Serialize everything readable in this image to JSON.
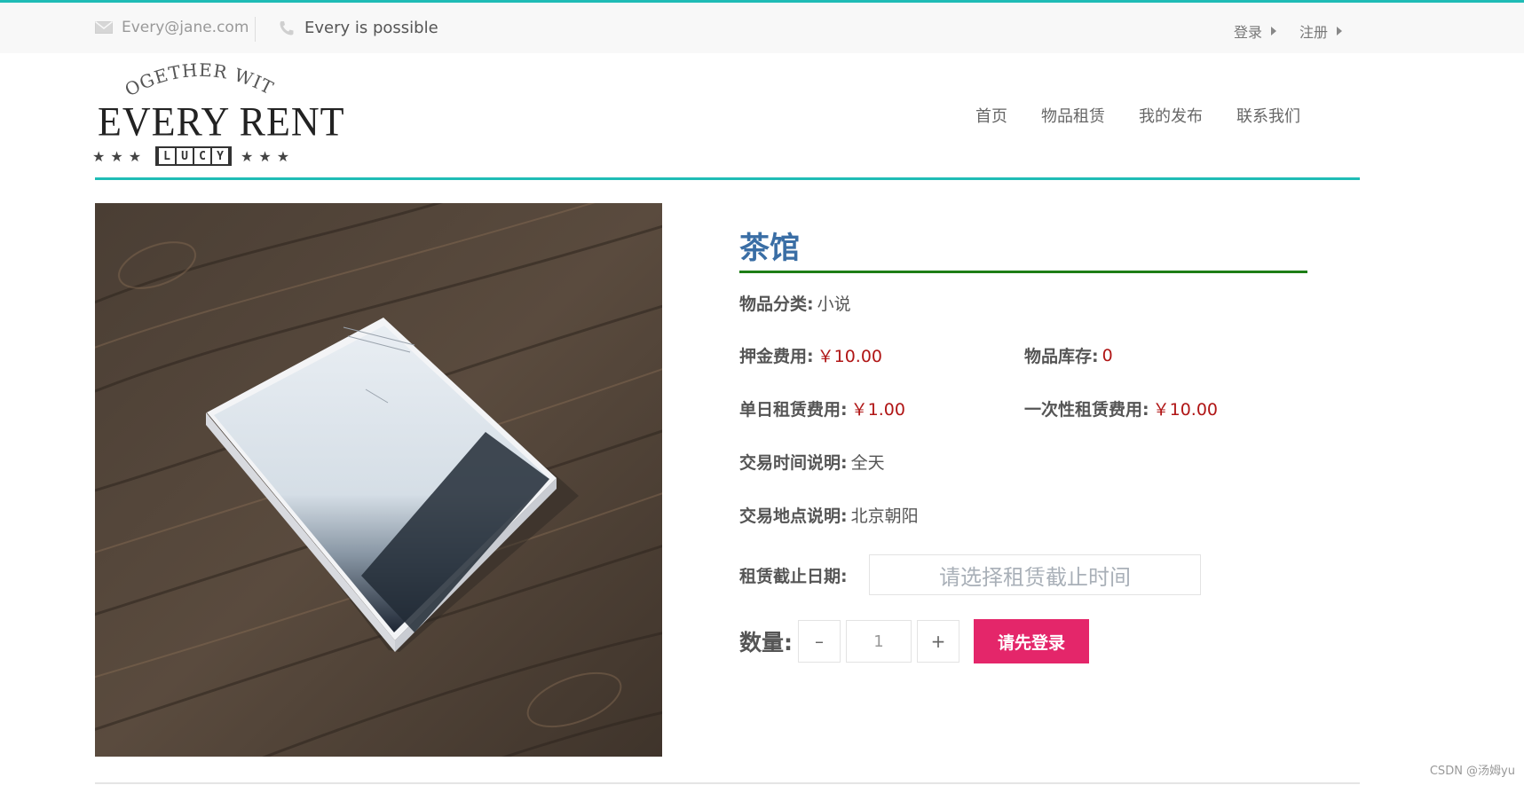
{
  "topbar": {
    "email": "Every@jane.com",
    "slogan": "Every is possible",
    "login": "登录",
    "register": "注册",
    "accent_color": "#1fbcb6"
  },
  "logo": {
    "arc_text": "TOGETHER WITH",
    "brand": "EVERY  RENT",
    "badge": [
      "L",
      "U",
      "C",
      "Y"
    ]
  },
  "nav": {
    "items": [
      "首页",
      "物品租赁",
      "我的发布",
      "联系我们"
    ]
  },
  "product": {
    "image_icon": "book-photo",
    "title": "茶馆",
    "category_label": "物品分类:",
    "category": "小说",
    "deposit_label": "押金费用:",
    "deposit": "￥10.00",
    "stock_label": "物品库存:",
    "stock": "0",
    "daily_label": "单日租赁费用:",
    "daily": "￥1.00",
    "onetime_label": "一次性租赁费用:",
    "onetime": "￥10.00",
    "time_label": "交易时间说明:",
    "time": "全天",
    "place_label": "交易地点说明:",
    "place": "北京朝阳",
    "deadline_label": "租赁截止日期:",
    "deadline_placeholder": "请选择租赁截止时间",
    "qty_label": "数量:",
    "qty_minus": "–",
    "qty_value": "1",
    "qty_plus": "+",
    "login_button": "请先登录"
  },
  "watermark": "CSDN @汤姆yu"
}
